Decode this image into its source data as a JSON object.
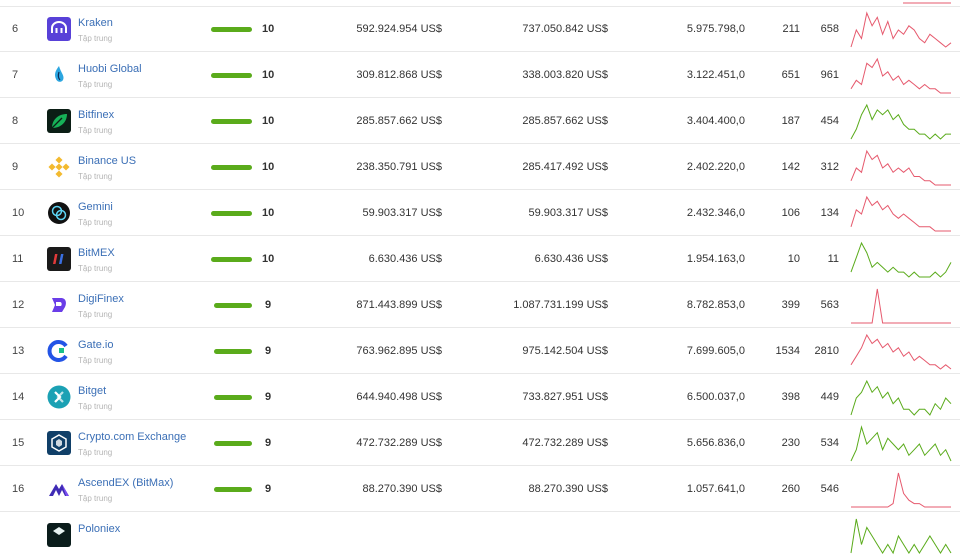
{
  "subtitle_text": "Tập trung",
  "colors": {
    "link": "#3b6fb6",
    "bar": "#5aab1b",
    "spark_up": "#5aab1b",
    "spark_down": "#e65a6e"
  },
  "rows": [
    {
      "rank": "6",
      "name": "Kraken",
      "score": "10",
      "score_fraction": 1.0,
      "volume": "592.924.954 US$",
      "avg_volume": "737.050.842 US$",
      "visits": "5.975.798,0",
      "markets": "211",
      "coins": "658",
      "trend": "down",
      "logo_icon": "kraken-icon",
      "logo_color": "#5841d8",
      "spark": [
        1,
        5,
        3,
        9,
        6,
        8,
        4,
        7,
        3,
        5,
        4,
        6,
        5,
        3,
        2,
        4,
        3,
        2,
        1,
        2
      ]
    },
    {
      "rank": "7",
      "name": "Huobi Global",
      "score": "10",
      "score_fraction": 1.0,
      "volume": "309.812.868 US$",
      "avg_volume": "338.003.820 US$",
      "visits": "3.122.451,0",
      "markets": "651",
      "coins": "961",
      "trend": "down",
      "logo_icon": "huobi-icon",
      "logo_color": "#2ca6e0",
      "spark": [
        2,
        4,
        3,
        8,
        7,
        9,
        5,
        6,
        4,
        5,
        3,
        4,
        3,
        2,
        3,
        2,
        2,
        1,
        1,
        1
      ]
    },
    {
      "rank": "8",
      "name": "Bitfinex",
      "score": "10",
      "score_fraction": 1.0,
      "volume": "285.857.662 US$",
      "avg_volume": "285.857.662 US$",
      "visits": "3.404.400,0",
      "markets": "187",
      "coins": "454",
      "trend": "up",
      "logo_icon": "bitfinex-leaf-icon",
      "logo_color": "#16b157",
      "spark": [
        1,
        3,
        6,
        8,
        5,
        7,
        6,
        7,
        5,
        6,
        4,
        3,
        3,
        2,
        2,
        1,
        2,
        1,
        2,
        2
      ]
    },
    {
      "rank": "9",
      "name": "Binance US",
      "score": "10",
      "score_fraction": 1.0,
      "volume": "238.350.791 US$",
      "avg_volume": "285.417.492 US$",
      "visits": "2.402.220,0",
      "markets": "142",
      "coins": "312",
      "trend": "down",
      "logo_icon": "binance-icon",
      "logo_color": "#f3ba2f",
      "spark": [
        2,
        5,
        4,
        9,
        7,
        8,
        5,
        6,
        4,
        5,
        4,
        5,
        3,
        3,
        2,
        2,
        1,
        1,
        1,
        1
      ]
    },
    {
      "rank": "10",
      "name": "Gemini",
      "score": "10",
      "score_fraction": 1.0,
      "volume": "59.903.317 US$",
      "avg_volume": "59.903.317 US$",
      "visits": "2.432.346,0",
      "markets": "106",
      "coins": "134",
      "trend": "down",
      "logo_icon": "gemini-icon",
      "logo_color": "#111111",
      "spark": [
        2,
        6,
        5,
        9,
        7,
        8,
        6,
        7,
        5,
        4,
        5,
        4,
        3,
        2,
        2,
        2,
        1,
        1,
        1,
        1
      ]
    },
    {
      "rank": "11",
      "name": "BitMEX",
      "score": "10",
      "score_fraction": 1.0,
      "volume": "6.630.436 US$",
      "avg_volume": "6.630.436 US$",
      "visits": "1.954.163,0",
      "markets": "10",
      "coins": "11",
      "trend": "up",
      "logo_icon": "bitmex-icon",
      "logo_color": "#1a1a1a",
      "spark": [
        2,
        5,
        8,
        6,
        3,
        4,
        3,
        2,
        3,
        2,
        2,
        1,
        2,
        1,
        1,
        1,
        2,
        1,
        2,
        4
      ]
    },
    {
      "rank": "12",
      "name": "DigiFinex",
      "score": "9",
      "score_fraction": 0.92,
      "volume": "871.443.899 US$",
      "avg_volume": "1.087.731.199 US$",
      "visits": "8.782.853,0",
      "markets": "399",
      "coins": "563",
      "trend": "down",
      "logo_icon": "digifinex-icon",
      "logo_color": "#6a3de8",
      "spark": [
        0,
        0,
        0,
        0,
        0,
        10,
        0,
        0,
        0,
        0,
        0,
        0,
        0,
        0,
        0,
        0,
        0,
        0,
        0,
        0
      ]
    },
    {
      "rank": "13",
      "name": "Gate.io",
      "score": "9",
      "score_fraction": 0.92,
      "volume": "763.962.895 US$",
      "avg_volume": "975.142.504 US$",
      "visits": "7.699.605,0",
      "markets": "1534",
      "coins": "2810",
      "trend": "down",
      "logo_icon": "gateio-icon",
      "logo_color": "#2354e6",
      "spark": [
        2,
        4,
        6,
        9,
        7,
        8,
        6,
        7,
        5,
        6,
        4,
        5,
        3,
        4,
        3,
        2,
        2,
        1,
        2,
        1
      ]
    },
    {
      "rank": "14",
      "name": "Bitget",
      "score": "9",
      "score_fraction": 0.92,
      "volume": "644.940.498 US$",
      "avg_volume": "733.827.951 US$",
      "visits": "6.500.037,0",
      "markets": "398",
      "coins": "449",
      "trend": "up",
      "logo_icon": "bitget-icon",
      "logo_color": "#1ba1b4",
      "spark": [
        2,
        5,
        6,
        8,
        6,
        7,
        5,
        6,
        4,
        5,
        3,
        3,
        2,
        3,
        3,
        2,
        4,
        3,
        5,
        4
      ]
    },
    {
      "rank": "15",
      "name": "Crypto.com Exchange",
      "score": "9",
      "score_fraction": 0.92,
      "volume": "472.732.289 US$",
      "avg_volume": "472.732.289 US$",
      "visits": "5.656.836,0",
      "markets": "230",
      "coins": "534",
      "trend": "up",
      "logo_icon": "cryptocom-icon",
      "logo_color": "#103f68",
      "spark": [
        2,
        4,
        8,
        5,
        6,
        7,
        4,
        6,
        5,
        4,
        5,
        3,
        4,
        5,
        3,
        4,
        5,
        3,
        4,
        2
      ]
    },
    {
      "rank": "16",
      "name": "AscendEX (BitMax)",
      "score": "9",
      "score_fraction": 0.92,
      "volume": "88.270.390 US$",
      "avg_volume": "88.270.390 US$",
      "visits": "1.057.641,0",
      "markets": "260",
      "coins": "546",
      "trend": "down",
      "logo_icon": "ascendex-icon",
      "logo_color": "#3f2bb5",
      "spark": [
        0,
        0,
        0,
        0,
        0,
        0,
        0,
        0,
        1,
        10,
        4,
        2,
        1,
        1,
        0,
        0,
        0,
        0,
        0,
        0
      ]
    },
    {
      "rank": "",
      "name": "Poloniex",
      "score": "",
      "score_fraction": 0,
      "volume": "",
      "avg_volume": "",
      "visits": "",
      "markets": "",
      "coins": "",
      "trend": "up",
      "logo_icon": "poloniex-icon",
      "logo_color": "#0a1c1b",
      "spark": [
        2,
        6,
        3,
        5,
        4,
        3,
        2,
        3,
        2,
        4,
        3,
        2,
        3,
        2,
        3,
        4,
        3,
        2,
        3,
        2
      ]
    }
  ]
}
